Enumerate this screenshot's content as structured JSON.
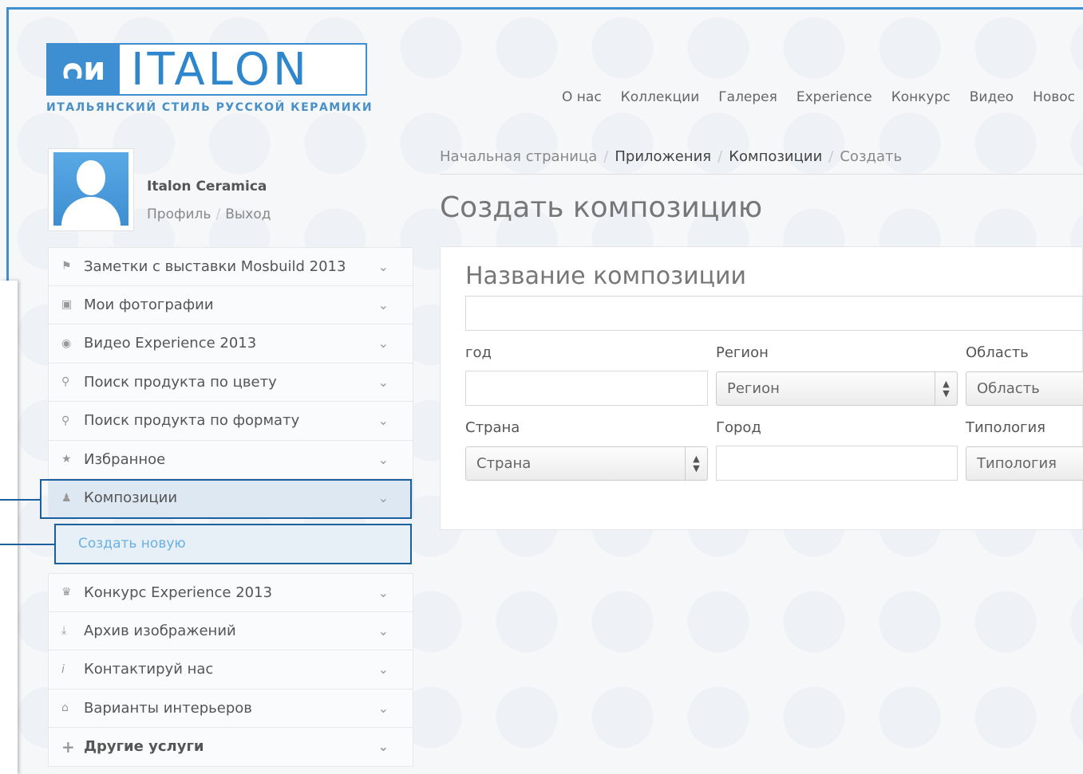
{
  "logo": {
    "mark": "ᴒᴎ",
    "text": "ITALON",
    "tagline": "ИТАЛЬЯНСКИЙ СТИЛЬ РУССКОЙ КЕРАМИКИ"
  },
  "topnav": [
    "О нас",
    "Коллекции",
    "Галерея",
    "Experience",
    "Конкурс",
    "Видео",
    "Новос"
  ],
  "user": {
    "name": "Italon Ceramica",
    "profile_link": "Профиль",
    "separator": "/",
    "logout_link": "Выход"
  },
  "sidebar": {
    "items": [
      {
        "icon": "flag-icon",
        "glyph": "⚑",
        "label": "Заметки с выставки Mosbuild 2013"
      },
      {
        "icon": "image-icon",
        "glyph": "▣",
        "label": "Мои фотографии"
      },
      {
        "icon": "play-icon",
        "glyph": "◉",
        "label": "Видео Experience 2013"
      },
      {
        "icon": "search-icon",
        "glyph": "⚲",
        "label": "Поиск продукта по цвету"
      },
      {
        "icon": "search-icon",
        "glyph": "⚲",
        "label": "Поиск продукта по формату"
      },
      {
        "icon": "star-icon",
        "glyph": "★",
        "label": "Избранное"
      },
      {
        "icon": "user-icon",
        "glyph": "♟",
        "label": "Композиции"
      }
    ],
    "submenu_item": "Создать новую",
    "items2": [
      {
        "icon": "trophy-icon",
        "glyph": "♛",
        "label": "Конкурс Experience 2013"
      },
      {
        "icon": "download-icon",
        "glyph": "⤓",
        "label": "Архив изображений"
      },
      {
        "icon": "info-icon",
        "glyph": "i",
        "label": "Контактируй нас"
      },
      {
        "icon": "home-icon",
        "glyph": "⌂",
        "label": "Варианты интерьеров"
      },
      {
        "icon": "plus-icon",
        "glyph": "+",
        "label": "Другие услуги"
      }
    ],
    "chevron": "⌄"
  },
  "breadcrumb": {
    "home": "Начальная страница",
    "apps": "Приложения",
    "compositions": "Композиции",
    "current": "Создать",
    "separator": "/"
  },
  "page_title": "Создать композицию",
  "form": {
    "heading": "Название композиции",
    "name_value": "",
    "year_label": "год",
    "year_value": "",
    "region_label": "Регион",
    "region_selected": "Регион",
    "area_label": "Область",
    "area_selected": "Область",
    "country_label": "Страна",
    "country_selected": "Страна",
    "city_label": "Город",
    "city_value": "",
    "typology_label": "Типология",
    "typology_selected": "Типология",
    "select_arrows": "▲▼"
  }
}
